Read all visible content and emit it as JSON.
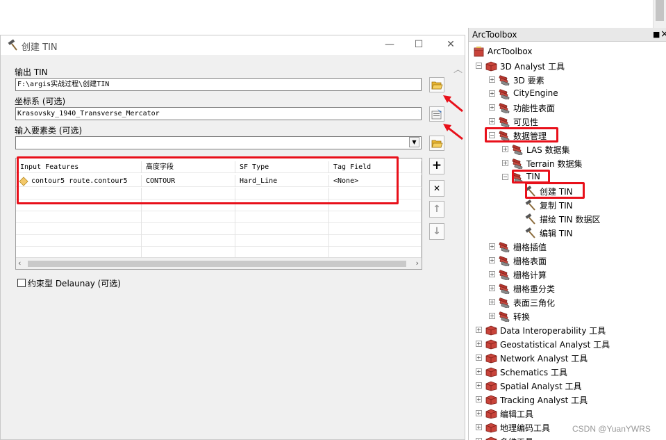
{
  "dialog": {
    "title": "创建 TIN",
    "minimize": "—",
    "maximize": "☐",
    "close": "✕",
    "output_label": "输出 TIN",
    "output_value": "F:\\argis实战过程\\创建TIN",
    "coord_label": "坐标系 (可选)",
    "coord_value": "Krasovsky_1940_Transverse_Mercator",
    "input_label": "输入要素类 (可选)",
    "input_value": "",
    "table": {
      "headers": [
        "Input Features",
        "高度字段",
        "SF Type",
        "Tag Field"
      ],
      "rows": [
        [
          "contour5 route.contour5",
          "CONTOUR",
          "Hard_Line",
          "<None>"
        ]
      ]
    },
    "checkbox_label": "约束型 Delaunay (可选)",
    "add_symbol": "+",
    "remove_symbol": "✕",
    "up_symbol": "↑",
    "down_symbol": "↓"
  },
  "toolbox": {
    "title": "ArcToolbox",
    "pin": "■",
    "close": "×",
    "items": [
      {
        "label": "ArcToolbox",
        "exp": ""
      },
      {
        "label": "3D Analyst 工具",
        "exp": "−"
      },
      {
        "label": "3D 要素",
        "exp": "+"
      },
      {
        "label": "CityEngine",
        "exp": "+"
      },
      {
        "label": "功能性表面",
        "exp": "+"
      },
      {
        "label": "可见性",
        "exp": "+"
      },
      {
        "label": "数据管理",
        "exp": "−"
      },
      {
        "label": "LAS 数据集",
        "exp": "+"
      },
      {
        "label": "Terrain 数据集",
        "exp": "+"
      },
      {
        "label": "TIN",
        "exp": "−"
      },
      {
        "label": "创建 TIN",
        "exp": ""
      },
      {
        "label": "复制 TIN",
        "exp": ""
      },
      {
        "label": "描绘 TIN 数据区",
        "exp": ""
      },
      {
        "label": "编辑 TIN",
        "exp": ""
      },
      {
        "label": "栅格插值",
        "exp": "+"
      },
      {
        "label": "栅格表面",
        "exp": "+"
      },
      {
        "label": "栅格计算",
        "exp": "+"
      },
      {
        "label": "栅格重分类",
        "exp": "+"
      },
      {
        "label": "表面三角化",
        "exp": "+"
      },
      {
        "label": "转换",
        "exp": "+"
      },
      {
        "label": "Data Interoperability 工具",
        "exp": "+"
      },
      {
        "label": "Geostatistical Analyst 工具",
        "exp": "+"
      },
      {
        "label": "Network Analyst 工具",
        "exp": "+"
      },
      {
        "label": "Schematics 工具",
        "exp": "+"
      },
      {
        "label": "Spatial Analyst 工具",
        "exp": "+"
      },
      {
        "label": "Tracking Analyst 工具",
        "exp": "+"
      },
      {
        "label": "编辑工具",
        "exp": "+"
      },
      {
        "label": "地理编码工具",
        "exp": "+"
      },
      {
        "label": "多维工具",
        "exp": "+"
      }
    ]
  },
  "watermark": "CSDN @YuanYWRS",
  "colors": {
    "highlight": "#e8101a",
    "toolbox_icon": "#b4342c"
  }
}
